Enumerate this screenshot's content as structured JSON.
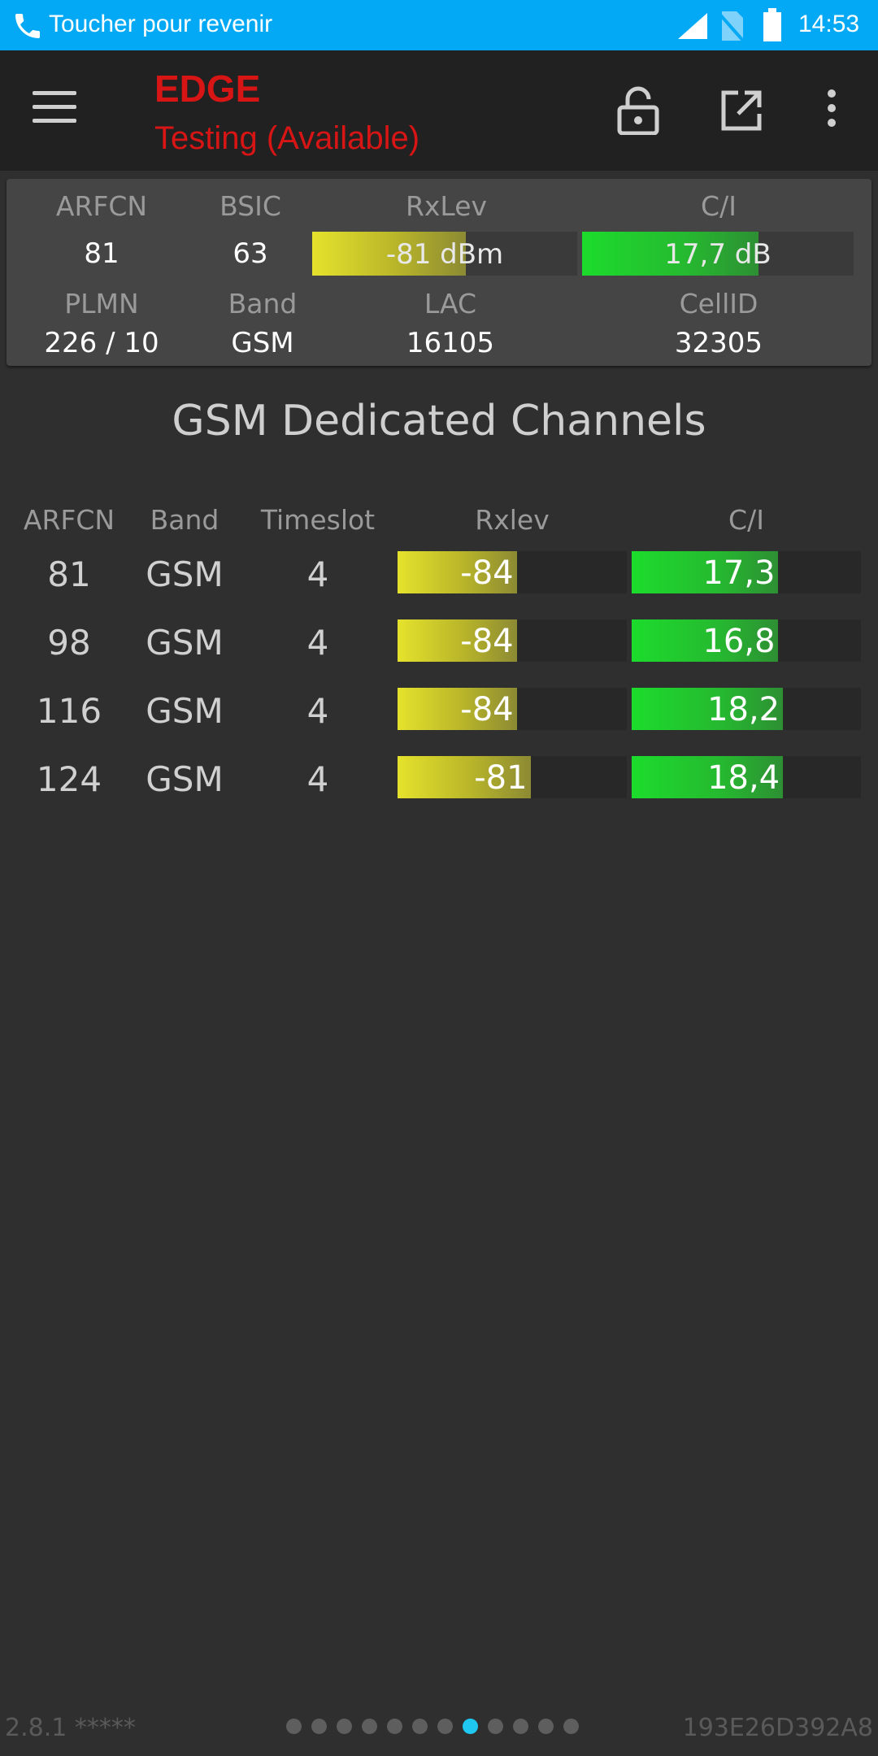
{
  "status_bar": {
    "return_text": "Toucher pour revenir",
    "time": "14:53"
  },
  "toolbar": {
    "technology": "EDGE",
    "status": "Testing (Available)"
  },
  "panel": {
    "arfcn_label": "ARFCN",
    "arfcn": "81",
    "bsic_label": "BSIC",
    "bsic": "63",
    "rxlev_label": "RxLev",
    "rxlev": "-81 dBm",
    "rxlev_fraction": 0.58,
    "ci_label": "C/I",
    "ci": "17,7 dB",
    "ci_fraction": 0.65,
    "plmn_label": "PLMN",
    "plmn": "226 / 10",
    "band_label": "Band",
    "band": "GSM",
    "lac_label": "LAC",
    "lac": "16105",
    "cellid_label": "CellID",
    "cellid": "32305"
  },
  "section": {
    "title": "GSM Dedicated Channels"
  },
  "table": {
    "headers": {
      "arfcn": "ARFCN",
      "band": "Band",
      "timeslot": "Timeslot",
      "rxlev": "Rxlev",
      "ci": "C/I"
    },
    "rows": [
      {
        "arfcn": "81",
        "band": "GSM",
        "timeslot": "4",
        "rxlev": "-84",
        "rxlev_fraction": 0.52,
        "ci": "17,3",
        "ci_fraction": 0.64
      },
      {
        "arfcn": "98",
        "band": "GSM",
        "timeslot": "4",
        "rxlev": "-84",
        "rxlev_fraction": 0.52,
        "ci": "16,8",
        "ci_fraction": 0.64
      },
      {
        "arfcn": "116",
        "band": "GSM",
        "timeslot": "4",
        "rxlev": "-84",
        "rxlev_fraction": 0.52,
        "ci": "18,2",
        "ci_fraction": 0.66
      },
      {
        "arfcn": "124",
        "band": "GSM",
        "timeslot": "4",
        "rxlev": "-81",
        "rxlev_fraction": 0.58,
        "ci": "18,4",
        "ci_fraction": 0.66
      }
    ]
  },
  "footer": {
    "version": "2.8.1 *****",
    "device_id": "193E26D392A8",
    "page_count": 12,
    "active_page": 8
  },
  "colors": {
    "accent": "#03a9f4",
    "tech_red": "#d81515",
    "active_dot": "#1ec8f0"
  }
}
